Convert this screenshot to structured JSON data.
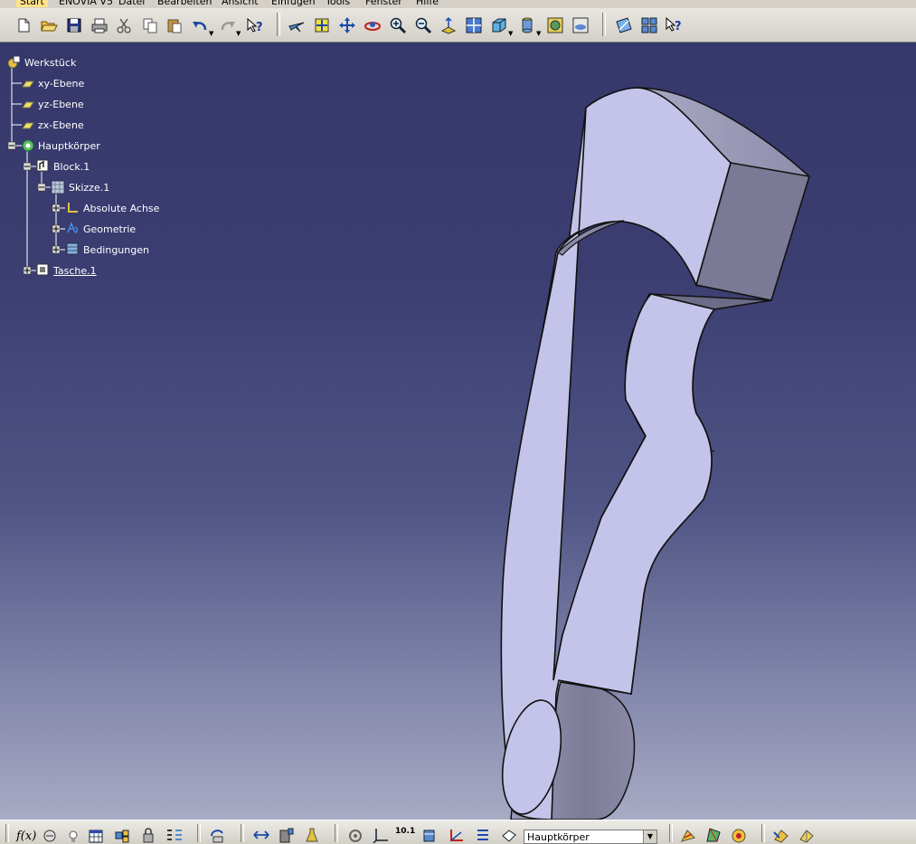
{
  "menu": {
    "items": [
      "Start",
      "ENOVIA V5",
      "Datei",
      "Bearbeiten",
      "Ansicht",
      "Einfügen",
      "Tools",
      "Fenster",
      "Hilfe"
    ]
  },
  "toolbar_top": {
    "icons": [
      "new-icon",
      "open-icon",
      "save-icon",
      "print-icon",
      "cut-icon",
      "copy-icon",
      "paste-icon",
      "undo-icon",
      "redo-icon",
      "whats-this-icon",
      "fly-mode-icon",
      "fit-all-icon",
      "pan-icon",
      "rotate-icon",
      "zoom-in-icon",
      "zoom-out-icon",
      "normal-view-icon",
      "multi-view-icon",
      "iso-view-icon",
      "shading-icon",
      "hide-show-icon",
      "swap-visible-icon",
      "sketcher-icon",
      "multi-sketch-icon",
      "help-cursor-icon"
    ]
  },
  "spec_tree": {
    "root": "Werkstück",
    "planes": [
      "xy-Ebene",
      "yz-Ebene",
      "zx-Ebene"
    ],
    "body": "Hauptkörper",
    "block": "Block.1",
    "sketch": "Skizze.1",
    "sketch_children": [
      "Absolute Achse",
      "Geometrie",
      "Bedingungen"
    ],
    "pocket": "Tasche.1"
  },
  "toolbar_bottom": {
    "current_body": "Hauptkörper",
    "formula_label": "f(x)",
    "scale_label": "10.1"
  },
  "colors": {
    "viewport_top": "#36376a",
    "viewport_bottom": "#a8abc4",
    "part_face": "#c0c0e8",
    "part_side": "#8a8aa8",
    "menu_active": "#ffe28a"
  }
}
